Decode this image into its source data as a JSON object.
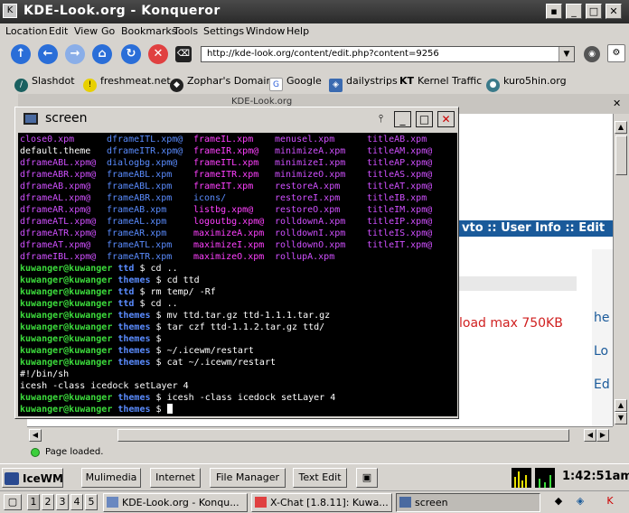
{
  "window": {
    "title": "KDE-Look.org - Konqueror"
  },
  "menu": [
    "Location",
    "Edit",
    "View",
    "Go",
    "Bookmarks",
    "Tools",
    "Settings",
    "Window",
    "Help"
  ],
  "url": "http://kde-look.org/content/edit.php?content=9256",
  "bookmarks": [
    "Slashdot",
    "freshmeat.net",
    "Zophar's Domain",
    "Google",
    "dailystrips",
    "Kernel Traffic",
    "kuro5hin.org"
  ],
  "bookmark_icons": {
    "kernel_traffic": "KT"
  },
  "page": {
    "tab_partial": "KDE-Look.org",
    "header_partial": "vto :: User Info :: Edit",
    "upload_text": "load max 750KB",
    "side_letters": [
      "he",
      "Lo",
      "Ed"
    ],
    "side_box_letter": "!"
  },
  "status": "Page loaded.",
  "terminal": {
    "title": "screen",
    "ls": [
      [
        "close0.xpm",
        "dframeITL.xpm@",
        "frameIL.xpm",
        "menusel.xpm",
        "titleAB.xpm"
      ],
      [
        "default.theme",
        "dframeITR.xpm@",
        "frameIR.xpm@",
        "minimizeA.xpm",
        "titleAM.xpm@"
      ],
      [
        "dframeABL.xpm@",
        "dialogbg.xpm@",
        "frameITL.xpm",
        "minimizeI.xpm",
        "titleAP.xpm@"
      ],
      [
        "dframeABR.xpm@",
        "frameABL.xpm",
        "frameITR.xpm",
        "minimizeO.xpm",
        "titleAS.xpm@"
      ],
      [
        "dframeAB.xpm@",
        "frameABL.xpm",
        "frameIT.xpm",
        "restoreA.xpm",
        "titleAT.xpm@"
      ],
      [
        "dframeAL.xpm@",
        "frameABR.xpm",
        "icons/",
        "restoreI.xpm",
        "titleIB.xpm"
      ],
      [
        "dframeAR.xpm@",
        "frameAB.xpm",
        "listbg.xpm@",
        "restoreO.xpm",
        "titleIM.xpm@"
      ],
      [
        "dframeATL.xpm@",
        "frameAL.xpm",
        "logoutbg.xpm@",
        "rolldownA.xpm",
        "titleIP.xpm@"
      ],
      [
        "dframeATR.xpm@",
        "frameAR.xpm",
        "maximizeA.xpm",
        "rolldownI.xpm",
        "titleIS.xpm@"
      ],
      [
        "dframeAT.xpm@",
        "frameATL.xpm",
        "maximizeI.xpm",
        "rolldownO.xpm",
        "titleIT.xpm@"
      ],
      [
        "dframeIBL.xpm@",
        "frameATR.xpm",
        "maximizeO.xpm",
        "rollupA.xpm",
        ""
      ]
    ],
    "lines": [
      {
        "user": "kuwanger@kuwanger",
        "dir": "ttd",
        "cmd": "$ cd .."
      },
      {
        "user": "kuwanger@kuwanger",
        "dir": "themes",
        "cmd": "$ cd ttd"
      },
      {
        "user": "kuwanger@kuwanger",
        "dir": "ttd",
        "cmd": "$ rm temp/ -Rf"
      },
      {
        "user": "kuwanger@kuwanger",
        "dir": "ttd",
        "cmd": "$ cd .."
      },
      {
        "user": "kuwanger@kuwanger",
        "dir": "themes",
        "cmd": "$ mv ttd.tar.gz ttd-1.1.1.tar.gz"
      },
      {
        "user": "kuwanger@kuwanger",
        "dir": "themes",
        "cmd": "$ tar czf ttd-1.1.2.tar.gz ttd/"
      },
      {
        "user": "kuwanger@kuwanger",
        "dir": "themes",
        "cmd": "$"
      },
      {
        "user": "kuwanger@kuwanger",
        "dir": "themes",
        "cmd": "$ ~/.icewm/restart"
      },
      {
        "user": "kuwanger@kuwanger",
        "dir": "themes",
        "cmd": "$ cat ~/.icewm/restart"
      },
      {
        "out": "#!/bin/sh"
      },
      {
        "out": "icesh -class icedock setLayer 4"
      },
      {
        "user": "kuwanger@kuwanger",
        "dir": "themes",
        "cmd": "$ icesh -class icedock setLayer 4"
      },
      {
        "user": "kuwanger@kuwanger",
        "dir": "themes",
        "cmd": "$",
        "cursor": true
      }
    ]
  },
  "taskbar": {
    "start": "IceWM",
    "quick": [
      "Mulimedia",
      "Internet",
      "File Manager",
      "Text Edit"
    ],
    "clock": "1:42:51am",
    "workspaces": [
      "1",
      "2",
      "3",
      "4",
      "5"
    ],
    "tasks": [
      "KDE-Look.org - Konqu...",
      "X-Chat [1.8.11]: Kuwa...",
      "screen"
    ]
  },
  "colors": {
    "ls_col1": "#d050ff",
    "ls_col2": "#5a8cff",
    "ls_col3": "#ff40ff",
    "ls_col4": "#d050ff",
    "ls_col5": "#d050ff",
    "prompt_user": "#3cdc3c",
    "prompt_dir": "#5a8cff"
  }
}
